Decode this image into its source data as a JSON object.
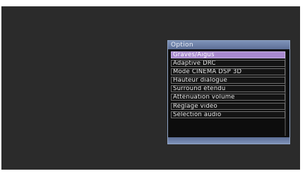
{
  "menu": {
    "title": "Option",
    "selected_index": 0,
    "items": [
      {
        "label": "Graves/Aigus"
      },
      {
        "label": "Adaptive DRC"
      },
      {
        "label": "Mode CINEMA DSP 3D"
      },
      {
        "label": "Hauteur dialogue"
      },
      {
        "label": "Surround étendu"
      },
      {
        "label": "Atténuation volume"
      },
      {
        "label": "Réglage vidéo"
      },
      {
        "label": "Sélection audio"
      }
    ]
  },
  "colors": {
    "background": "#2b2b2b",
    "title_bar": "#6f82aa",
    "selected_item": "#a889cf"
  }
}
